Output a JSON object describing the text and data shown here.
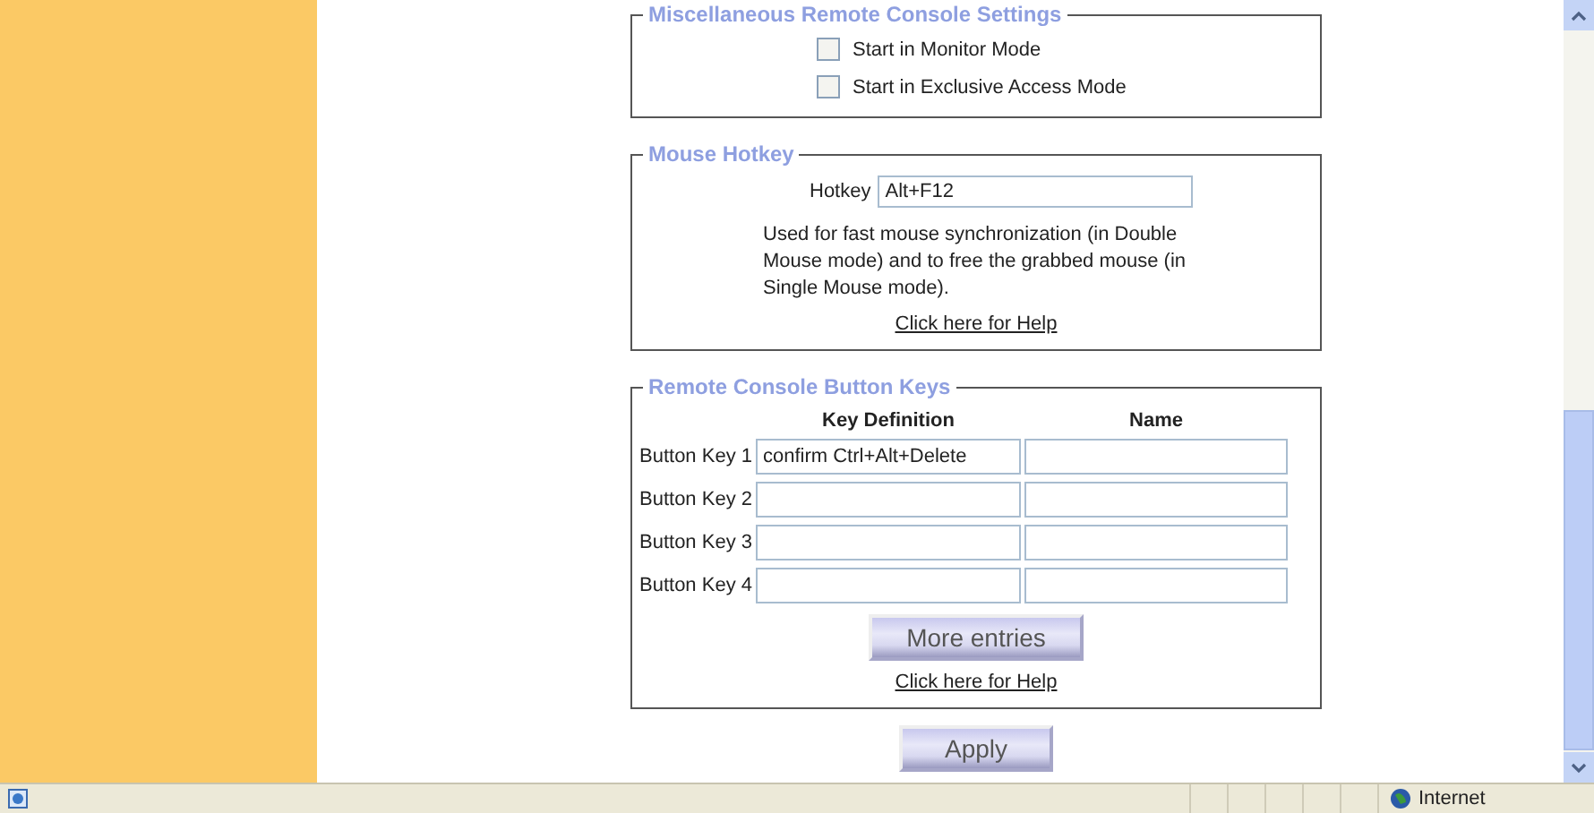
{
  "misc_settings": {
    "title": "Miscellaneous Remote Console Settings",
    "options": [
      {
        "label": "Start in Monitor Mode",
        "checked": false
      },
      {
        "label": "Start in Exclusive Access Mode",
        "checked": false
      }
    ]
  },
  "mouse_hotkey": {
    "title": "Mouse Hotkey",
    "hotkey_label": "Hotkey",
    "hotkey_value": "Alt+F12",
    "description": "Used for fast mouse synchronization (in Double Mouse mode) and to free the grabbed mouse (in Single Mouse mode).",
    "help_link": "Click here for Help"
  },
  "button_keys": {
    "title": "Remote Console Button Keys",
    "columns": [
      "Key Definition",
      "Name"
    ],
    "rows": [
      {
        "label": "Button Key 1",
        "definition": "confirm Ctrl+Alt+Delete"
      },
      {
        "label": "Button Key 2"
      },
      {
        "label": "Button Key 3"
      },
      {
        "label": "Button Key 4"
      }
    ],
    "more_button": "More entries",
    "help_link": "Click here for Help"
  },
  "apply_button": "Apply",
  "status_bar": {
    "zone": "Internet"
  }
}
